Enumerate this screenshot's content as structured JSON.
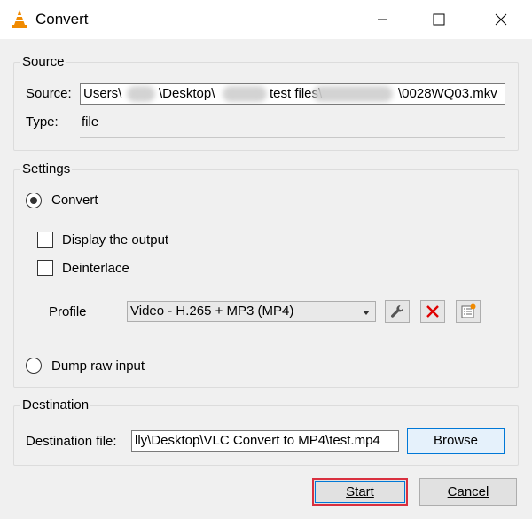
{
  "window": {
    "title": "Convert",
    "app_icon": "vlc-cone-icon",
    "controls": [
      "minimize-icon",
      "maximize-icon",
      "close-icon"
    ]
  },
  "source": {
    "group_title": "Source",
    "source_label": "Source:",
    "source_value_parts": [
      "Users\\",
      "\\Desktop\\",
      "test files\\",
      "\\0028WQ03.mkv"
    ],
    "type_label": "Type:",
    "type_value": "file"
  },
  "settings": {
    "group_title": "Settings",
    "convert_label": "Convert",
    "convert_selected": true,
    "display_output_label": "Display the output",
    "display_output_checked": false,
    "deinterlace_label": "Deinterlace",
    "deinterlace_checked": false,
    "profile_label": "Profile",
    "profile_value": "Video - H.265 + MP3 (MP4)",
    "profile_tools": [
      "wrench-icon",
      "delete-x-icon",
      "new-profile-icon"
    ],
    "dump_raw_label": "Dump raw input",
    "dump_raw_selected": false
  },
  "destination": {
    "group_title": "Destination",
    "dest_label": "Destination file:",
    "dest_value": "lly\\Desktop\\VLC Convert to MP4\\test.mp4",
    "browse_label": "Browse"
  },
  "footer": {
    "start_label": "Start",
    "cancel_label": "Cancel"
  },
  "colors": {
    "accent": "#0078d7",
    "start_border": "#d9303f",
    "vlc_orange": "#f08a00",
    "delete_red": "#e00000"
  }
}
